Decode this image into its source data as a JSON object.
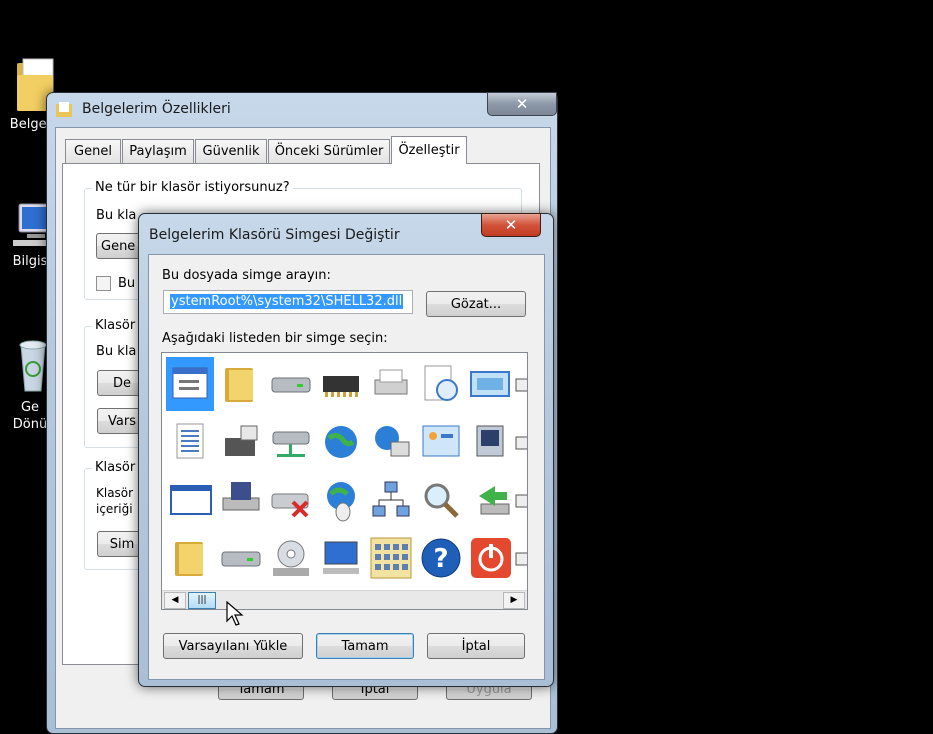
{
  "desktop": {
    "icons": [
      {
        "name": "folder-icon",
        "label": "Belgel"
      },
      {
        "name": "computer-icon",
        "label": "Bilgis"
      },
      {
        "name": "recycle-bin-icon",
        "label": "Ge\nDönü"
      }
    ]
  },
  "props_window": {
    "title": "Belgelerim Özellikleri",
    "tabs": [
      "Genel",
      "Paylaşım",
      "Güvenlik",
      "Önceki Sürümler",
      "Özelleştir"
    ],
    "active_tab": "Özelleştir",
    "question": "Ne tür bir klasör istiyorsunuz?",
    "partial_labels": {
      "bu_kla": "Bu kla",
      "gene_btn": "Gene",
      "bu_check": "Bu",
      "klasor_group": "Klasör",
      "bu_kla2": "Bu kla",
      "de_btn": "De",
      "vars_btn": "Vars",
      "klasor_group2": "Klasör",
      "klasor_line1": "Klasör",
      "icerigi": "içeriği",
      "sim_btn": "Sim"
    },
    "bottom_buttons": [
      "Tamam",
      "İptal",
      "Uygula"
    ]
  },
  "dialog": {
    "title": "Belgelerim Klasörü Simgesi Değiştir",
    "close_label": "✕",
    "search_label": "Bu dosyada simge arayın:",
    "path_value": "ystemRoot%\\system32\\SHELL32.dll",
    "browse_label": "Gözat...",
    "list_label": "Aşağıdaki listeden bir simge seçin:",
    "restore_label": "Varsayılanı Yükle",
    "ok_label": "Tamam",
    "cancel_label": "İptal",
    "icons": [
      [
        "window-doc-icon",
        "folder-icon",
        "drive-icon",
        "memory-chip-icon",
        "printer-icon",
        "clock-doc-icon",
        "display-icon"
      ],
      [
        "text-doc-icon",
        "server-icon",
        "network-drive-icon",
        "globe-icon",
        "network-globe-icon",
        "control-panel-icon",
        "media-icon"
      ],
      [
        "window-icon",
        "floppy-drive-icon",
        "drive-error-icon",
        "earth-mouse-icon",
        "network-icon",
        "magnifier-icon",
        "shortcut-arrow-icon"
      ],
      [
        "folder-icon",
        "drive-icon",
        "cd-drive-icon",
        "computer-icon",
        "keypad-icon",
        "help-icon",
        "power-icon"
      ]
    ]
  },
  "colors": {
    "selection": "#3399ff",
    "close_red": "#c23b22"
  }
}
